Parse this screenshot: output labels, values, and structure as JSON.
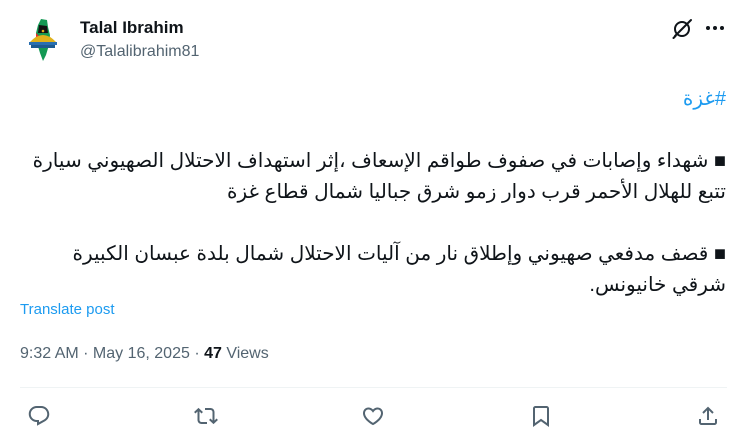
{
  "post": {
    "author": {
      "display_name": "Talal Ibrahim",
      "handle": "@Talalibrahim81",
      "avatar_icon": "palestine-map-dome-avatar"
    },
    "top_actions": {
      "grok_icon": "grok-icon",
      "more_icon": "more-dots-icon"
    },
    "hashtag": "#غزة",
    "paragraphs": [
      "■ شهداء وإصابات في صفوف طواقم الإسعاف ،إثر استهداف الاحتلال الصهيوني سيارة تتبع للهلال الأحمر قرب دوار زمو شرق جباليا شمال قطاع غزة",
      "■ قصف مدفعي صهيوني وإطلاق نار من آليات الاحتلال شمال بلدة عبسان الكبيرة شرقي خانيونس."
    ],
    "translate_label": "Translate post",
    "meta": {
      "time": "9:32 AM",
      "separator": " · ",
      "date": "May 16, 2025",
      "views_count": "47",
      "views_label": " Views"
    },
    "action_icons": [
      "reply-icon",
      "repost-icon",
      "like-icon",
      "bookmark-icon",
      "share-icon"
    ],
    "colors": {
      "link": "#1d9bf0",
      "text": "#0f1419",
      "secondary": "#536471",
      "divider": "#eff3f4"
    }
  }
}
